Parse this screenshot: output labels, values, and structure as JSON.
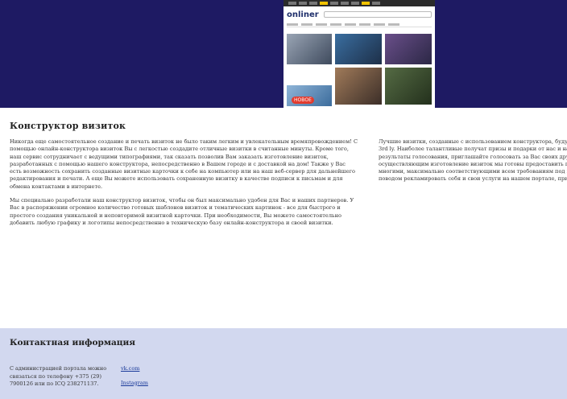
{
  "banner": {
    "colors": {
      "band": "#1e1a63",
      "accent": "#f2c300"
    },
    "site_logo": "onliner",
    "promo_badge": "НОВОЕ"
  },
  "main": {
    "title": "Конструктор визиток",
    "paragraphs_left": [
      "Никогда еще самостоятельное создание и печать визиток не было таким легким и увлекательным времяпровождением! С помощью онлайн-конструктора визиток Вы с легкостью создадите отличные визитки в считанные минуты. Кроме того, наш сервис сотрудничает с ведущими типографиями, так сказать позволив Вам заказать изготовление визиток, разработанных с помощью нашего конструктора, непосредственно в Вашем городе и с доставкой на дом! Также у Вас есть возможность сохранить созданные визитные карточки к себе на компьютер или на наш веб-сервер для дальнейшего редактирования и печати. А еще Вы можете использовать сохраненную визитку в качестве подписи к письмам и для обмена контактами в интернете.",
      "Мы специально разработали наш конструктор визиток, чтобы он был максимально удобен для Вас и наших партнеров. У Вас в распоряжении огромное количество готовых шаблонов визиток и тематических картинок - все для быстрого и простого создания уникальной и неповторимой визитной карточки. При необходимости, Вы можете самостоятельно добавить любую графику и логотипы непосредственно в техническую базу онлайн-конструктора и своей визитки."
    ],
    "paragraphs_right": [
      "Лучшие визитки, созданные с использованием конструктора, будут уча",
      "3rd ly. Наиболее талантливые получат призы и подарки от нас и наших",
      "результаты голосования, приглашайте голосовать за Вас своих друзей",
      "осуществляющим изготовление визиток мы готовы предоставить полн",
      "многими, максимально соответствующими всем требованиям под шаб",
      "поводом рекламировать себя и свои услуги на нашем портале, прихо"
    ]
  },
  "footer": {
    "title": "Контактная информация",
    "contact_text": "С администрацией портала можно связаться по телефону +375 (29) 7900126 или по ICQ 238271137.",
    "links": [
      "vk.com",
      "Instagram"
    ],
    "colors": {
      "background": "#d2d8ef",
      "link": "#1a3a9a"
    }
  }
}
